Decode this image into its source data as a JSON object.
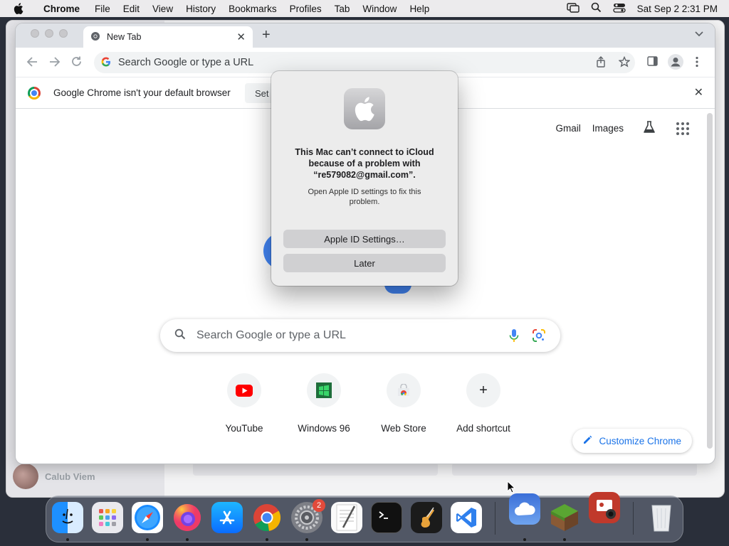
{
  "menubar": {
    "app_name": "Chrome",
    "menus": [
      "File",
      "Edit",
      "View",
      "History",
      "Bookmarks",
      "Profiles",
      "Tab",
      "Window",
      "Help"
    ],
    "date_time": "Sat Sep 2  2:31 PM"
  },
  "background_window": {
    "user_name": "Calub Viem"
  },
  "chrome": {
    "tab": {
      "title": "New Tab"
    },
    "omnibox": {
      "placeholder": "Search Google or type a URL"
    },
    "infobar": {
      "message": "Google Chrome isn't your default browser",
      "button_label": "Set"
    },
    "ntp": {
      "links": [
        "Gmail",
        "Images"
      ],
      "search_placeholder": "Search Google or type a URL",
      "shortcuts": [
        {
          "label": "YouTube",
          "icon": "youtube-icon"
        },
        {
          "label": "Windows 96",
          "icon": "windows96-icon"
        },
        {
          "label": "Web Store",
          "icon": "webstore-icon"
        },
        {
          "label": "Add shortcut",
          "icon": "plus-icon",
          "glyph": "+"
        }
      ],
      "customize_label": "Customize Chrome"
    }
  },
  "alert": {
    "title": "This Mac can’t connect to iCloud because of a problem with “re579082@gmail.com”.",
    "body": "Open Apple ID settings to fix this problem.",
    "primary_button": "Apple ID Settings…",
    "secondary_button": "Later"
  },
  "dock": {
    "system_settings_badge": "2",
    "items": [
      "Finder",
      "Launchpad",
      "Safari",
      "Firefox",
      "App Store",
      "Google Chrome",
      "System Settings",
      "TextEdit",
      "Terminal",
      "GarageBand",
      "Visual Studio Code",
      "Weather",
      "Minecraft",
      "Photo Booth",
      "Trash"
    ]
  },
  "colors": {
    "accent": "#1a73e8",
    "youtube_red": "#ff0000",
    "badge_red": "#e24a3b"
  }
}
